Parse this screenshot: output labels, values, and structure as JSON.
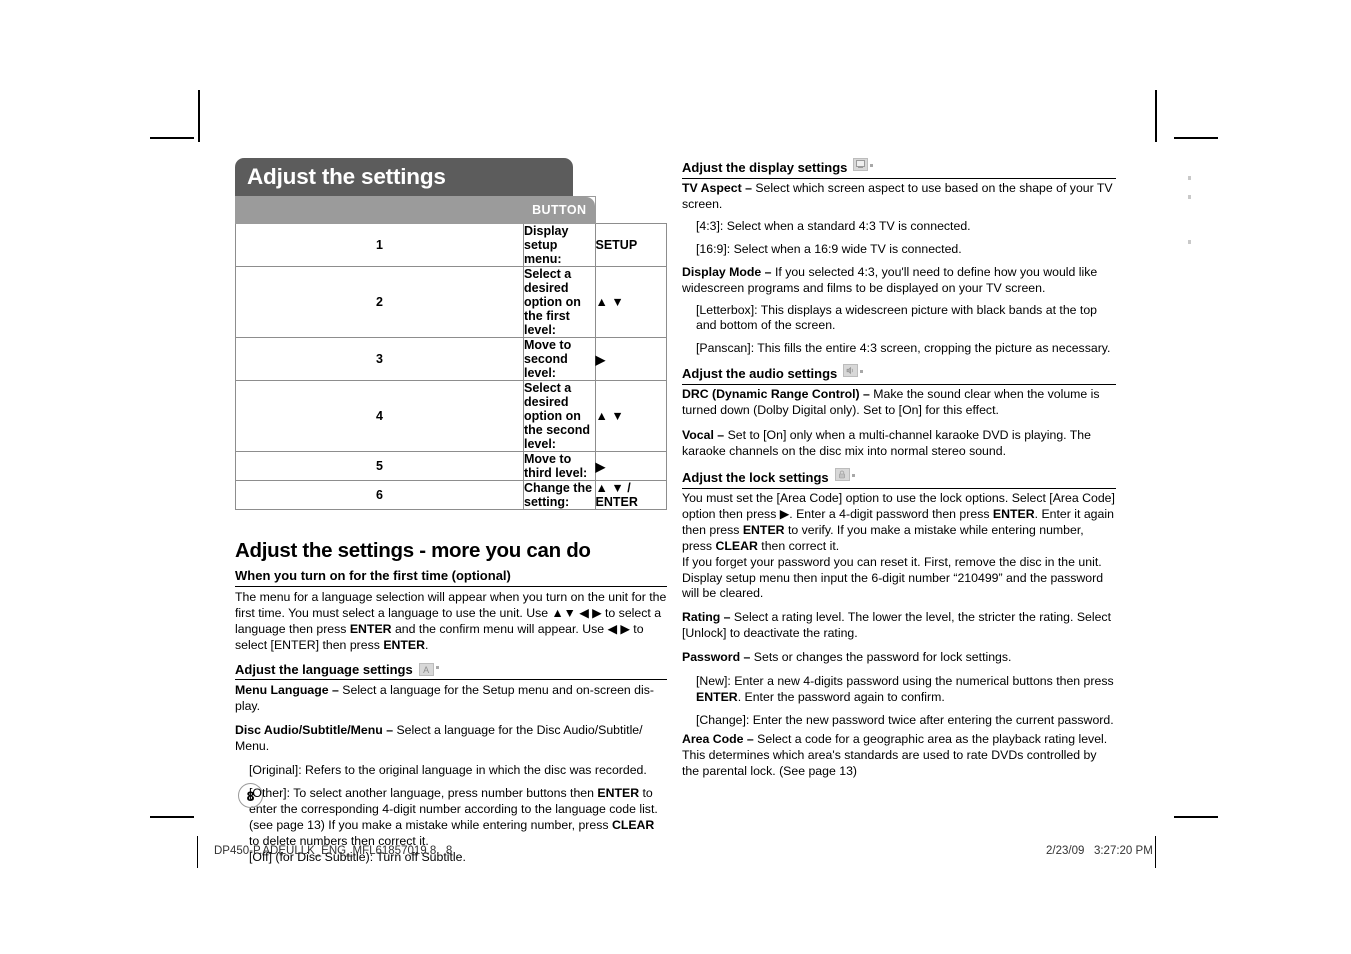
{
  "document": {
    "page_number": "8",
    "footer_file": "DP450-P.ADEULLK_ENG_MFL61857019.8   8",
    "footer_date": "2/23/09   3:27:20 PM"
  },
  "banner": {
    "title": "Adjust the settings"
  },
  "table": {
    "header_button": "BUTTON",
    "rows": [
      {
        "num": "1",
        "desc": "Display setup menu:",
        "button": "SETUP"
      },
      {
        "num": "2",
        "desc": "Select a desired option on the first level:",
        "button": "▲ ▼"
      },
      {
        "num": "3",
        "desc": "Move to second level:",
        "button": "▶"
      },
      {
        "num": "4",
        "desc": "Select a desired option on the second level:",
        "button": "▲ ▼"
      },
      {
        "num": "5",
        "desc": "Move to third level:",
        "button": "▶"
      },
      {
        "num": "6",
        "desc": "Change the setting:",
        "button": "▲ ▼ / ENTER"
      }
    ]
  },
  "left": {
    "section_title": "Adjust the settings - more you can do",
    "first_time": {
      "heading": "When you turn on for the first time (optional)",
      "body_1": "The menu for a language selection will appear when you turn on the unit for the first time. You must select a language to use the unit. Use ",
      "arrows_1": "▲▼ ◀ ▶",
      "body_2": " to select a language then press ",
      "enter_1": "ENTER",
      "body_3": " and the confirm menu will appear. Use ",
      "arrows_2": "◀ ▶",
      "body_4": " to select [ENTER] then press ",
      "enter_2": "ENTER",
      "body_5": "."
    },
    "language": {
      "heading": "Adjust the language settings",
      "menu_language_label": "Menu Language –",
      "menu_language_text": " Select a language for the Setup menu and on-screen dis-play.",
      "disc_audio_label": "Disc Audio/Subtitle/Menu –",
      "disc_audio_text": " Select a language for the Disc Audio/Subtitle/ Menu.",
      "original": "[Original]: Refers to the original language in which the disc was recorded.",
      "other_1": "[Other]: To select another language, press number buttons then ",
      "other_enter": "ENTER",
      "other_2": " to enter the corresponding 4-digit number according to the language code list. (see page 13) If you make a mistake while entering number, press ",
      "other_clear": "CLEAR",
      "other_3": " to delete numbers then correct it.",
      "off": "[Off] (for Disc Subtitle): Turn off Subtitle."
    }
  },
  "right": {
    "display": {
      "heading": "Adjust the display settings",
      "tv_aspect_label": "TV Aspect –",
      "tv_aspect_text": " Select which screen aspect to use based on the shape of your TV screen.",
      "aspect_43": "[4:3]: Select when a standard 4:3 TV is connected.",
      "aspect_169": "[16:9]: Select when a 16:9 wide TV is connected.",
      "display_mode_label": "Display Mode –",
      "display_mode_text": " If you selected 4:3, you'll need to define how you would like widescreen programs and films to be displayed on your TV screen.",
      "letterbox": "[Letterbox]: This displays a widescreen picture with black bands at the top and bottom of the screen.",
      "panscan": "[Panscan]: This fills the entire 4:3 screen, cropping the picture as necessary."
    },
    "audio": {
      "heading": "Adjust the audio settings",
      "drc_label": "DRC (Dynamic Range Control) –",
      "drc_text": " Make the sound clear when the volume is turned down (Dolby Digital only). Set to [On] for this effect.",
      "vocal_label": "Vocal –",
      "vocal_text": " Set to [On] only when a multi-channel karaoke DVD is playing. The karaoke channels on the disc mix into normal stereo sound."
    },
    "lock": {
      "heading": "Adjust the lock settings",
      "body_1": "You must set the [Area Code] option to use the lock options. Select [Area Code] option then press ",
      "arrow_1": "▶",
      "body_2": ". Enter a 4-digit password then press ",
      "enter_1": "ENTER",
      "body_3": ". Enter it again then press ",
      "enter_2": "ENTER",
      "body_4": " to verify. If you make a mistake while entering number, press ",
      "clear_1": "CLEAR",
      "body_5": " then correct it.",
      "reset_text": "If you forget your password you can reset it. First, remove the disc in the unit. Display setup menu then input the 6-digit number “210499” and the password will be cleared.",
      "rating_label": "Rating –",
      "rating_text": " Select a rating level. The lower the level, the stricter the rating. Select [Unlock] to deactivate the rating.",
      "password_label": "Password –",
      "password_text": " Sets or changes the password for lock settings.",
      "new_1": "[New]: Enter a new 4-digits password using the numerical buttons then press ",
      "new_enter": "ENTER",
      "new_2": ". Enter the password again to confirm.",
      "change": "[Change]: Enter the new password twice after entering the current password.",
      "area_code_label": "Area Code –",
      "area_code_text": " Select a code for a geographic area as the playback rating level. This determines which area's standards are used to rate DVDs controlled by the parental lock. (See page 13)"
    }
  },
  "colors": {
    "banner_bg": "#5c5c5c",
    "table_header_bg": "#9b9b9b",
    "badge_bg": "#d8d8d8",
    "rule": "#000000"
  }
}
